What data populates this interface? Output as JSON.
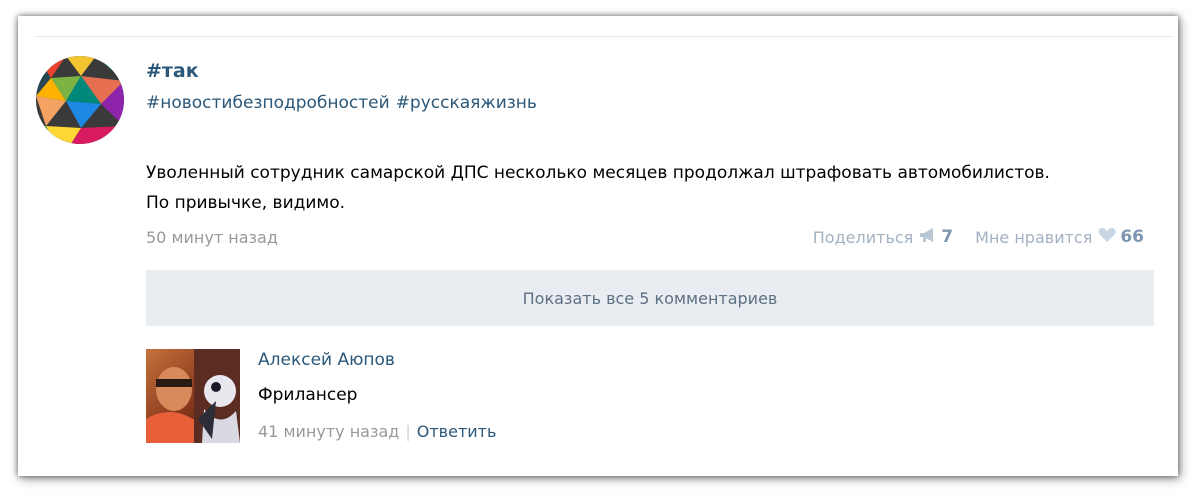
{
  "post": {
    "title": "#так",
    "hashtags": [
      "#новостибезподробностей",
      "#русскаяжизнь"
    ],
    "text_lines": [
      "Уволенный сотрудник самарской ДПС несколько месяцев продолжал штрафовать автомобилистов.",
      "По привычке, видимо."
    ],
    "time": "50 минут назад",
    "share_label": "Поделиться",
    "share_count": "7",
    "like_label": "Мне нравится",
    "like_count": "66",
    "share_icon": "megaphone-icon",
    "like_icon": "heart-icon"
  },
  "comments_button": "Показать все 5 комментариев",
  "comment": {
    "author": "Алексей Аюпов",
    "text": "Фрилансер",
    "time": "41 минуту назад",
    "separator": "|",
    "reply_label": "Ответить"
  },
  "colors": {
    "link": "#2b587a",
    "muted": "#999999",
    "action": "#a3b1c2",
    "button_bg": "#e9edf1"
  }
}
